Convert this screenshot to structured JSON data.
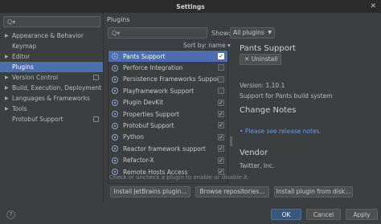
{
  "window": {
    "title": "Settings",
    "close_glyph": "✕"
  },
  "left": {
    "search_placeholder": "Q▾",
    "items": [
      {
        "label": "Appearance & Behavior",
        "expandable": true
      },
      {
        "label": "Keymap",
        "expandable": false
      },
      {
        "label": "Editor",
        "expandable": true
      },
      {
        "label": "Plugins",
        "expandable": false,
        "selected": true
      },
      {
        "label": "Version Control",
        "expandable": true,
        "project": true
      },
      {
        "label": "Build, Execution, Deployment",
        "expandable": true
      },
      {
        "label": "Languages & Frameworks",
        "expandable": true
      },
      {
        "label": "Tools",
        "expandable": true
      },
      {
        "label": "Protobuf Support",
        "expandable": false,
        "project": true
      }
    ]
  },
  "plugins": {
    "title": "Plugins",
    "search_placeholder": "Q▾",
    "show_label": "Show:",
    "show_value": "All plugins",
    "sort_label": "Sort by: name ▾",
    "list": [
      {
        "name": "Pants Support",
        "checked": true,
        "selected": true
      },
      {
        "name": "Perforce Integration",
        "checked": false
      },
      {
        "name": "Persistence Frameworks Support",
        "checked": false
      },
      {
        "name": "Playframework Support",
        "checked": false
      },
      {
        "name": "Plugin DevKit",
        "checked": true
      },
      {
        "name": "Properties Support",
        "checked": true
      },
      {
        "name": "Protobuf Support",
        "checked": true
      },
      {
        "name": "Python",
        "checked": true
      },
      {
        "name": "Reactor framework support",
        "checked": true
      },
      {
        "name": "Refactor-X",
        "checked": true
      },
      {
        "name": "Remote Hosts Access",
        "checked": true
      }
    ],
    "hint": "Check or uncheck a plugin to enable or disable it.",
    "buttons": {
      "install_jetbrains": "Install JetBrains plugin...",
      "browse": "Browse repositories...",
      "install_disk": "Install plugin from disk..."
    }
  },
  "detail": {
    "name": "Pants Support",
    "uninstall_label": "Uninstall",
    "version_text": "Version: 1.10.1",
    "support_text": "Support for Pants build system",
    "change_notes_heading": "Change Notes",
    "release_link": "Please see release notes.",
    "vendor_heading": "Vendor",
    "vendor_name": "Twitter, Inc."
  },
  "footer": {
    "ok_label": "OK",
    "cancel_label": "Cancel",
    "apply_label": "Apply",
    "help_label": "?"
  },
  "colors": {
    "background": "#3c3f41",
    "selection": "#4b6eaf",
    "link": "#589df6",
    "ok_button": "#365880"
  }
}
